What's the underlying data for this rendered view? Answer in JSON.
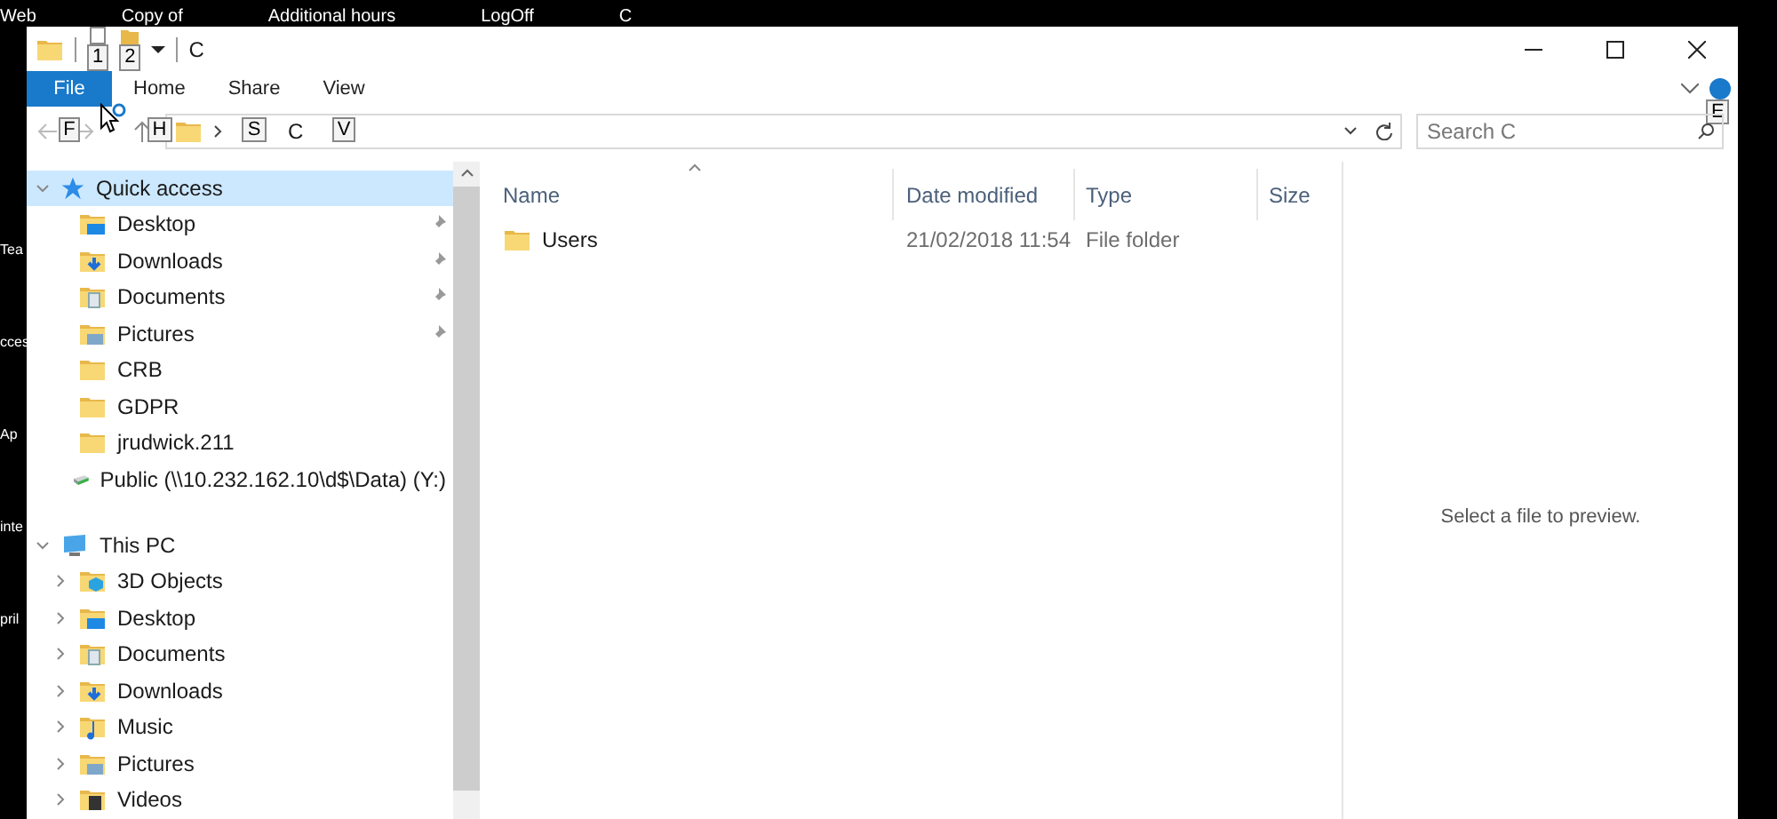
{
  "desktop": {
    "top_labels": [
      "Web",
      "Copy of",
      "Additional hours",
      "LogOff",
      "C"
    ],
    "left_labels": [
      "Tea",
      "cces",
      "Ap",
      "inte",
      "pril"
    ]
  },
  "window": {
    "title": "C",
    "quick_keytips": [
      "1",
      "2"
    ]
  },
  "ribbon": {
    "tabs": [
      {
        "label": "File",
        "keytip": "F",
        "selected": true
      },
      {
        "label": "Home",
        "keytip": "H",
        "selected": false
      },
      {
        "label": "Share",
        "keytip": "S",
        "selected": false
      },
      {
        "label": "View",
        "keytip": "V",
        "selected": false
      }
    ],
    "help_keytip": "E"
  },
  "address": {
    "path": "C",
    "search_placeholder": "Search C"
  },
  "nav": [
    {
      "label": "Quick access",
      "kind": "star",
      "expanded": true,
      "selected": true,
      "children": [
        {
          "label": "Desktop",
          "kind": "desktop",
          "pinned": true
        },
        {
          "label": "Downloads",
          "kind": "downloads",
          "pinned": true
        },
        {
          "label": "Documents",
          "kind": "documents",
          "pinned": true
        },
        {
          "label": "Pictures",
          "kind": "pictures",
          "pinned": true
        },
        {
          "label": "CRB",
          "kind": "folder",
          "pinned": false
        },
        {
          "label": "GDPR",
          "kind": "folder",
          "pinned": false
        },
        {
          "label": "jrudwick.211",
          "kind": "folder",
          "pinned": false
        },
        {
          "label": "Public (\\\\10.232.162.10\\d$\\Data) (Y:)",
          "kind": "drive",
          "pinned": false
        }
      ]
    },
    {
      "label": "This PC",
      "kind": "pc",
      "expanded": true,
      "selected": false,
      "children": [
        {
          "label": "3D Objects",
          "kind": "objects",
          "expanded": false
        },
        {
          "label": "Desktop",
          "kind": "desktop",
          "expanded": false
        },
        {
          "label": "Documents",
          "kind": "documents",
          "expanded": false
        },
        {
          "label": "Downloads",
          "kind": "downloads",
          "expanded": false
        },
        {
          "label": "Music",
          "kind": "music",
          "expanded": false
        },
        {
          "label": "Pictures",
          "kind": "pictures",
          "expanded": false
        },
        {
          "label": "Videos",
          "kind": "videos",
          "expanded": false
        }
      ]
    }
  ],
  "table": {
    "columns": [
      "Name",
      "Date modified",
      "Type",
      "Size"
    ],
    "rows": [
      {
        "name": "Users",
        "date_modified": "21/02/2018 11:54",
        "type": "File folder"
      }
    ]
  },
  "preview": {
    "message": "Select a file to preview."
  }
}
